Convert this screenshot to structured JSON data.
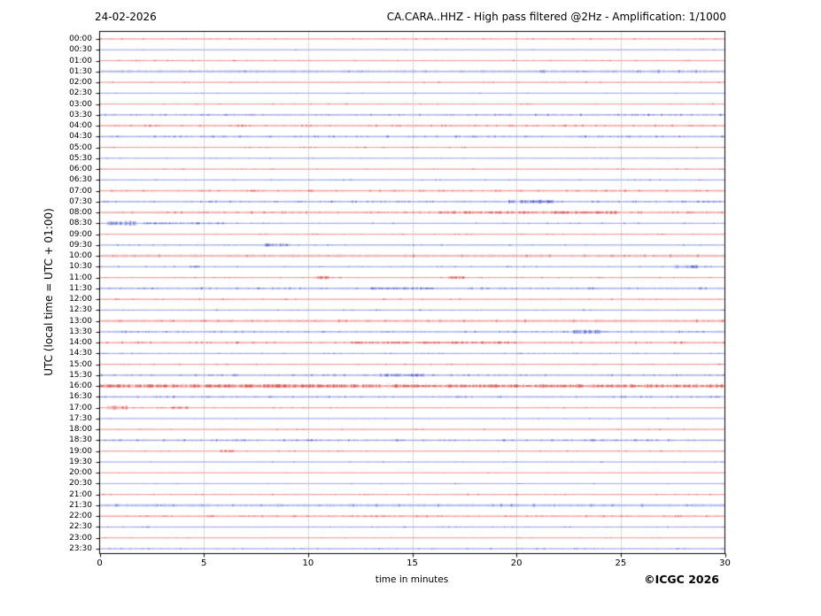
{
  "header": {
    "date": "24-02-2026",
    "title": "CA.CARA..HHZ - High pass filtered @2Hz - Amplification: 1/1000"
  },
  "footer": {
    "copyright": "©ICGC 2026"
  },
  "chart_data": {
    "type": "line",
    "subtype": "helicorder-daily-seismogram",
    "station": "CA.CARA..HHZ",
    "filter": "High pass filtered @2Hz",
    "amplification": "1/1000",
    "date": "24-02-2026",
    "title": "CA.CARA..HHZ - High pass filtered @2Hz - Amplification: 1/1000",
    "xlabel": "time in minutes",
    "ylabel": "UTC (local time = UTC + 01:00)",
    "xlim": [
      0,
      30
    ],
    "x_ticks": [
      "0",
      "5",
      "10",
      "15",
      "20",
      "25",
      "30"
    ],
    "grid_minutes": [
      5,
      10,
      15,
      20,
      25
    ],
    "minutes_per_row": 30,
    "grid_on": true,
    "palette": {
      "red_light": "#f49a9a",
      "red_dark": "#cd2626",
      "blue_light": "#9da8eb",
      "blue_dark": "#2838be",
      "grid": "#8a8a8a",
      "frame": "#000000"
    },
    "rows": [
      {
        "time": "00:00",
        "color": "red",
        "activity": "normal",
        "bursts": []
      },
      {
        "time": "00:30",
        "color": "blue",
        "activity": "quiet",
        "bursts": []
      },
      {
        "time": "01:00",
        "color": "red",
        "activity": "normal",
        "bursts": []
      },
      {
        "time": "01:30",
        "color": "blue",
        "activity": "band",
        "bursts": []
      },
      {
        "time": "02:00",
        "color": "red",
        "activity": "normal",
        "bursts": []
      },
      {
        "time": "02:30",
        "color": "blue",
        "activity": "quiet",
        "bursts": []
      },
      {
        "time": "03:00",
        "color": "red",
        "activity": "normal",
        "bursts": []
      },
      {
        "time": "03:30",
        "color": "blue",
        "activity": "elevated",
        "bursts": []
      },
      {
        "time": "04:00",
        "color": "red",
        "activity": "elevated",
        "bursts": []
      },
      {
        "time": "04:30",
        "color": "blue",
        "activity": "elevated",
        "bursts": []
      },
      {
        "time": "05:00",
        "color": "red",
        "activity": "normal",
        "bursts": []
      },
      {
        "time": "05:30",
        "color": "blue",
        "activity": "quiet",
        "bursts": []
      },
      {
        "time": "06:00",
        "color": "red",
        "activity": "normal",
        "bursts": []
      },
      {
        "time": "06:30",
        "color": "blue",
        "activity": "normal",
        "bursts": []
      },
      {
        "time": "07:00",
        "color": "red",
        "activity": "elevated",
        "bursts": []
      },
      {
        "time": "07:30",
        "color": "blue",
        "activity": "elevated",
        "bursts": [
          [
            19.6,
            21.8,
            1.6
          ]
        ]
      },
      {
        "time": "08:00",
        "color": "red",
        "activity": "elevated",
        "bursts": [
          [
            16.0,
            25.0,
            1.2
          ]
        ]
      },
      {
        "time": "08:30",
        "color": "blue",
        "activity": "normal",
        "bursts": [
          [
            0.3,
            1.7,
            2.2
          ],
          [
            2.0,
            6.0,
            0.9
          ]
        ]
      },
      {
        "time": "09:00",
        "color": "red",
        "activity": "normal",
        "bursts": []
      },
      {
        "time": "09:30",
        "color": "blue",
        "activity": "normal",
        "bursts": [
          [
            7.9,
            9.1,
            1.4
          ]
        ]
      },
      {
        "time": "10:00",
        "color": "red",
        "activity": "band",
        "bursts": []
      },
      {
        "time": "10:30",
        "color": "blue",
        "activity": "normal",
        "bursts": [
          [
            4.3,
            4.8,
            1.0
          ],
          [
            27.5,
            28.7,
            1.6
          ]
        ]
      },
      {
        "time": "11:00",
        "color": "red",
        "activity": "normal",
        "bursts": [
          [
            10.3,
            11.0,
            1.4
          ],
          [
            16.7,
            17.5,
            1.4
          ]
        ]
      },
      {
        "time": "11:30",
        "color": "blue",
        "activity": "elevated",
        "bursts": [
          [
            13.0,
            16.0,
            1.0
          ]
        ]
      },
      {
        "time": "12:00",
        "color": "red",
        "activity": "normal",
        "bursts": []
      },
      {
        "time": "12:30",
        "color": "blue",
        "activity": "normal",
        "bursts": []
      },
      {
        "time": "13:00",
        "color": "red",
        "activity": "band",
        "bursts": []
      },
      {
        "time": "13:30",
        "color": "blue",
        "activity": "elevated",
        "bursts": [
          [
            22.7,
            24.0,
            1.9
          ]
        ]
      },
      {
        "time": "14:00",
        "color": "red",
        "activity": "elevated",
        "bursts": [
          [
            12.0,
            20.0,
            1.0
          ]
        ]
      },
      {
        "time": "14:30",
        "color": "blue",
        "activity": "normal",
        "bursts": []
      },
      {
        "time": "15:00",
        "color": "red",
        "activity": "normal",
        "bursts": []
      },
      {
        "time": "15:30",
        "color": "blue",
        "activity": "elevated",
        "bursts": [
          [
            13.4,
            15.6,
            1.3
          ]
        ]
      },
      {
        "time": "16:00",
        "color": "red",
        "activity": "high",
        "bursts": [
          [
            0.0,
            13.5,
            1.6
          ],
          [
            14.0,
            30.0,
            1.0
          ]
        ]
      },
      {
        "time": "16:30",
        "color": "blue",
        "activity": "elevated",
        "bursts": []
      },
      {
        "time": "17:00",
        "color": "red",
        "activity": "normal",
        "bursts": [
          [
            0.3,
            1.3,
            2.0
          ],
          [
            3.4,
            4.3,
            1.2
          ]
        ]
      },
      {
        "time": "17:30",
        "color": "blue",
        "activity": "quiet",
        "bursts": []
      },
      {
        "time": "18:00",
        "color": "red",
        "activity": "normal",
        "bursts": []
      },
      {
        "time": "18:30",
        "color": "blue",
        "activity": "elevated",
        "bursts": []
      },
      {
        "time": "19:00",
        "color": "red",
        "activity": "normal",
        "bursts": [
          [
            5.8,
            6.5,
            1.2
          ]
        ]
      },
      {
        "time": "19:30",
        "color": "blue",
        "activity": "quiet",
        "bursts": []
      },
      {
        "time": "20:00",
        "color": "red",
        "activity": "quiet",
        "bursts": []
      },
      {
        "time": "20:30",
        "color": "blue",
        "activity": "quiet",
        "bursts": []
      },
      {
        "time": "21:00",
        "color": "red",
        "activity": "normal",
        "bursts": []
      },
      {
        "time": "21:30",
        "color": "blue",
        "activity": "band",
        "bursts": []
      },
      {
        "time": "22:00",
        "color": "red",
        "activity": "elevated",
        "bursts": []
      },
      {
        "time": "22:30",
        "color": "blue",
        "activity": "normal",
        "bursts": []
      },
      {
        "time": "23:00",
        "color": "red",
        "activity": "quiet",
        "bursts": []
      },
      {
        "time": "23:30",
        "color": "blue",
        "activity": "normal",
        "bursts": []
      }
    ]
  }
}
